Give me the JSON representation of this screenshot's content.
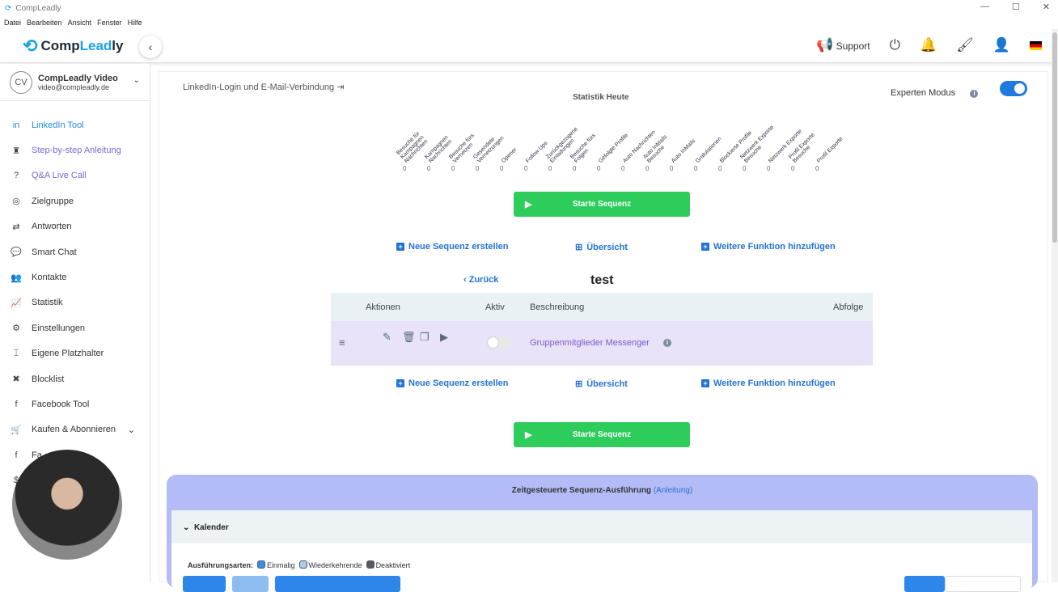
{
  "window": {
    "title": "CompLeadly",
    "min": "—",
    "max": "☐",
    "close": "✕"
  },
  "menu": [
    "Datei",
    "Bearbeiten",
    "Ansicht",
    "Fenster",
    "Hilfe"
  ],
  "header": {
    "logo_a": "Comp",
    "logo_b": "Lead",
    "logo_c": "ly",
    "support": "Support"
  },
  "user": {
    "initials": "CV",
    "name": "CompLeadly Video",
    "email": "video@compleadly.de"
  },
  "nav": [
    {
      "label": "LinkedIn Tool",
      "icon": "in"
    },
    {
      "label": "Step-by-step Anleitung",
      "icon": "♜"
    },
    {
      "label": "Q&A Live Call",
      "icon": "?"
    },
    {
      "label": "Zielgruppe",
      "icon": "◎"
    },
    {
      "label": "Antworten",
      "icon": "⇄"
    },
    {
      "label": "Smart Chat",
      "icon": "💬"
    },
    {
      "label": "Kontakte",
      "icon": "👥"
    },
    {
      "label": "Statistik",
      "icon": "📈"
    },
    {
      "label": "Einstellungen",
      "icon": "⚙"
    },
    {
      "label": "Eigene Platzhalter",
      "icon": "⌶"
    },
    {
      "label": "Blocklist",
      "icon": "✖"
    },
    {
      "label": "Facebook Tool",
      "icon": "f"
    },
    {
      "label": "Kaufen & Abonnieren",
      "icon": "🛒"
    },
    {
      "label": "Fa",
      "icon": "f"
    },
    {
      "label": "",
      "icon": "$"
    }
  ],
  "main": {
    "login_link": "LinkedIn-Login und E-Mail-Verbindung",
    "stats_title": "Statistik Heute",
    "expert_mode": "Experten Modus",
    "expert_mode_on": true,
    "stats": [
      {
        "label": "Besuche für\nKampagnen\nNachrichten",
        "value": "0"
      },
      {
        "label": "Kampagnen\nNachrichten",
        "value": "0"
      },
      {
        "label": "Besuche fürs\nVernetzen",
        "value": "0"
      },
      {
        "label": "Gesendete\nVernetzungen",
        "value": "0"
      },
      {
        "label": "Opener",
        "value": "0"
      },
      {
        "label": "Follow Ups",
        "value": "0"
      },
      {
        "label": "Zurückgezogene\nEinladungen",
        "value": "0"
      },
      {
        "label": "Besuche fürs\nFolgen",
        "value": "0"
      },
      {
        "label": "Gefolgte Profile",
        "value": "0"
      },
      {
        "label": "Auto Nachrichten",
        "value": "0"
      },
      {
        "label": "Auto InMails\nBesuche",
        "value": "0"
      },
      {
        "label": "Auto InMails",
        "value": "0"
      },
      {
        "label": "Gratulationen",
        "value": "0"
      },
      {
        "label": "Blockierte Profile",
        "value": "0"
      },
      {
        "label": "Netzwerk Exporte\nBesuche",
        "value": "0"
      },
      {
        "label": "Netzwerk Exporte",
        "value": "0"
      },
      {
        "label": "Profil Exporte\nBesuche",
        "value": "0"
      },
      {
        "label": "Profil Exporte",
        "value": "0"
      }
    ],
    "start_sequence": "Starte Sequenz",
    "new_sequence": "Neue Sequenz erstellen",
    "overview": "Übersicht",
    "add_function": "Weitere Funktion hinzufügen",
    "back": "Zurück",
    "sequence_name": "test",
    "table": {
      "headers": [
        "Aktionen",
        "Aktiv",
        "Beschreibung",
        "Abfolge"
      ],
      "rows": [
        {
          "active": false,
          "description": "Gruppenmitglieder Messenger"
        }
      ]
    },
    "scheduled": {
      "title": "Zeitgesteuerte Sequenz-Ausführung",
      "guide": "(Anleitung)",
      "calendar": "Kalender",
      "types_label": "Ausführungsarten:",
      "types": [
        {
          "label": "Einmalig",
          "color": "#3a8ee8"
        },
        {
          "label": "Wiederkehrende",
          "color": "#a9ccf0"
        },
        {
          "label": "Deaktiviert",
          "color": "#555a66"
        }
      ]
    }
  }
}
